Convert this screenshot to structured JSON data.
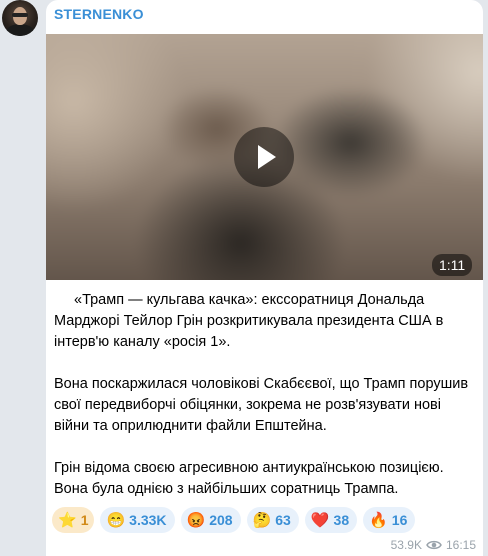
{
  "channel": {
    "name": "STERNENKO"
  },
  "video": {
    "duration": "1:11"
  },
  "post": {
    "paragraphs": [
      "«Трамп — кульгава качка»: екссоратниця Дональда Марджорі Тейлор Грін розкритикувала президента США в інтерв'ю каналу «росія 1».",
      "Вона поскаржилася чоловікові Скабєєвої, що Трамп порушив свої передвиборчі обіцянки, зокрема не розв'язувати нові війни та оприлюднити файли Епштейна.",
      "Грін відома своєю агресивною антиукраїнською позицією. Вона була однією з найбільших соратниць Трампа."
    ]
  },
  "reactions": [
    {
      "emoji": "⭐",
      "icon": "star-icon",
      "count": "1"
    },
    {
      "emoji": "😁",
      "icon": "grin-icon",
      "count": "3.33K"
    },
    {
      "emoji": "😡",
      "icon": "angry-face-icon",
      "count": "208"
    },
    {
      "emoji": "🤔",
      "icon": "thinking-face-icon",
      "count": "63"
    },
    {
      "emoji": "❤️",
      "icon": "heart-icon",
      "count": "38"
    },
    {
      "emoji": "🔥",
      "icon": "fire-icon",
      "count": "16"
    }
  ],
  "footer": {
    "views": "53.9K",
    "time": "16:15"
  },
  "colors": {
    "accent": "#3a8fd6",
    "reaction_bg": "#e8f1fb",
    "star_bg": "#fbe9c9",
    "meta_text": "#9aa3ab"
  }
}
